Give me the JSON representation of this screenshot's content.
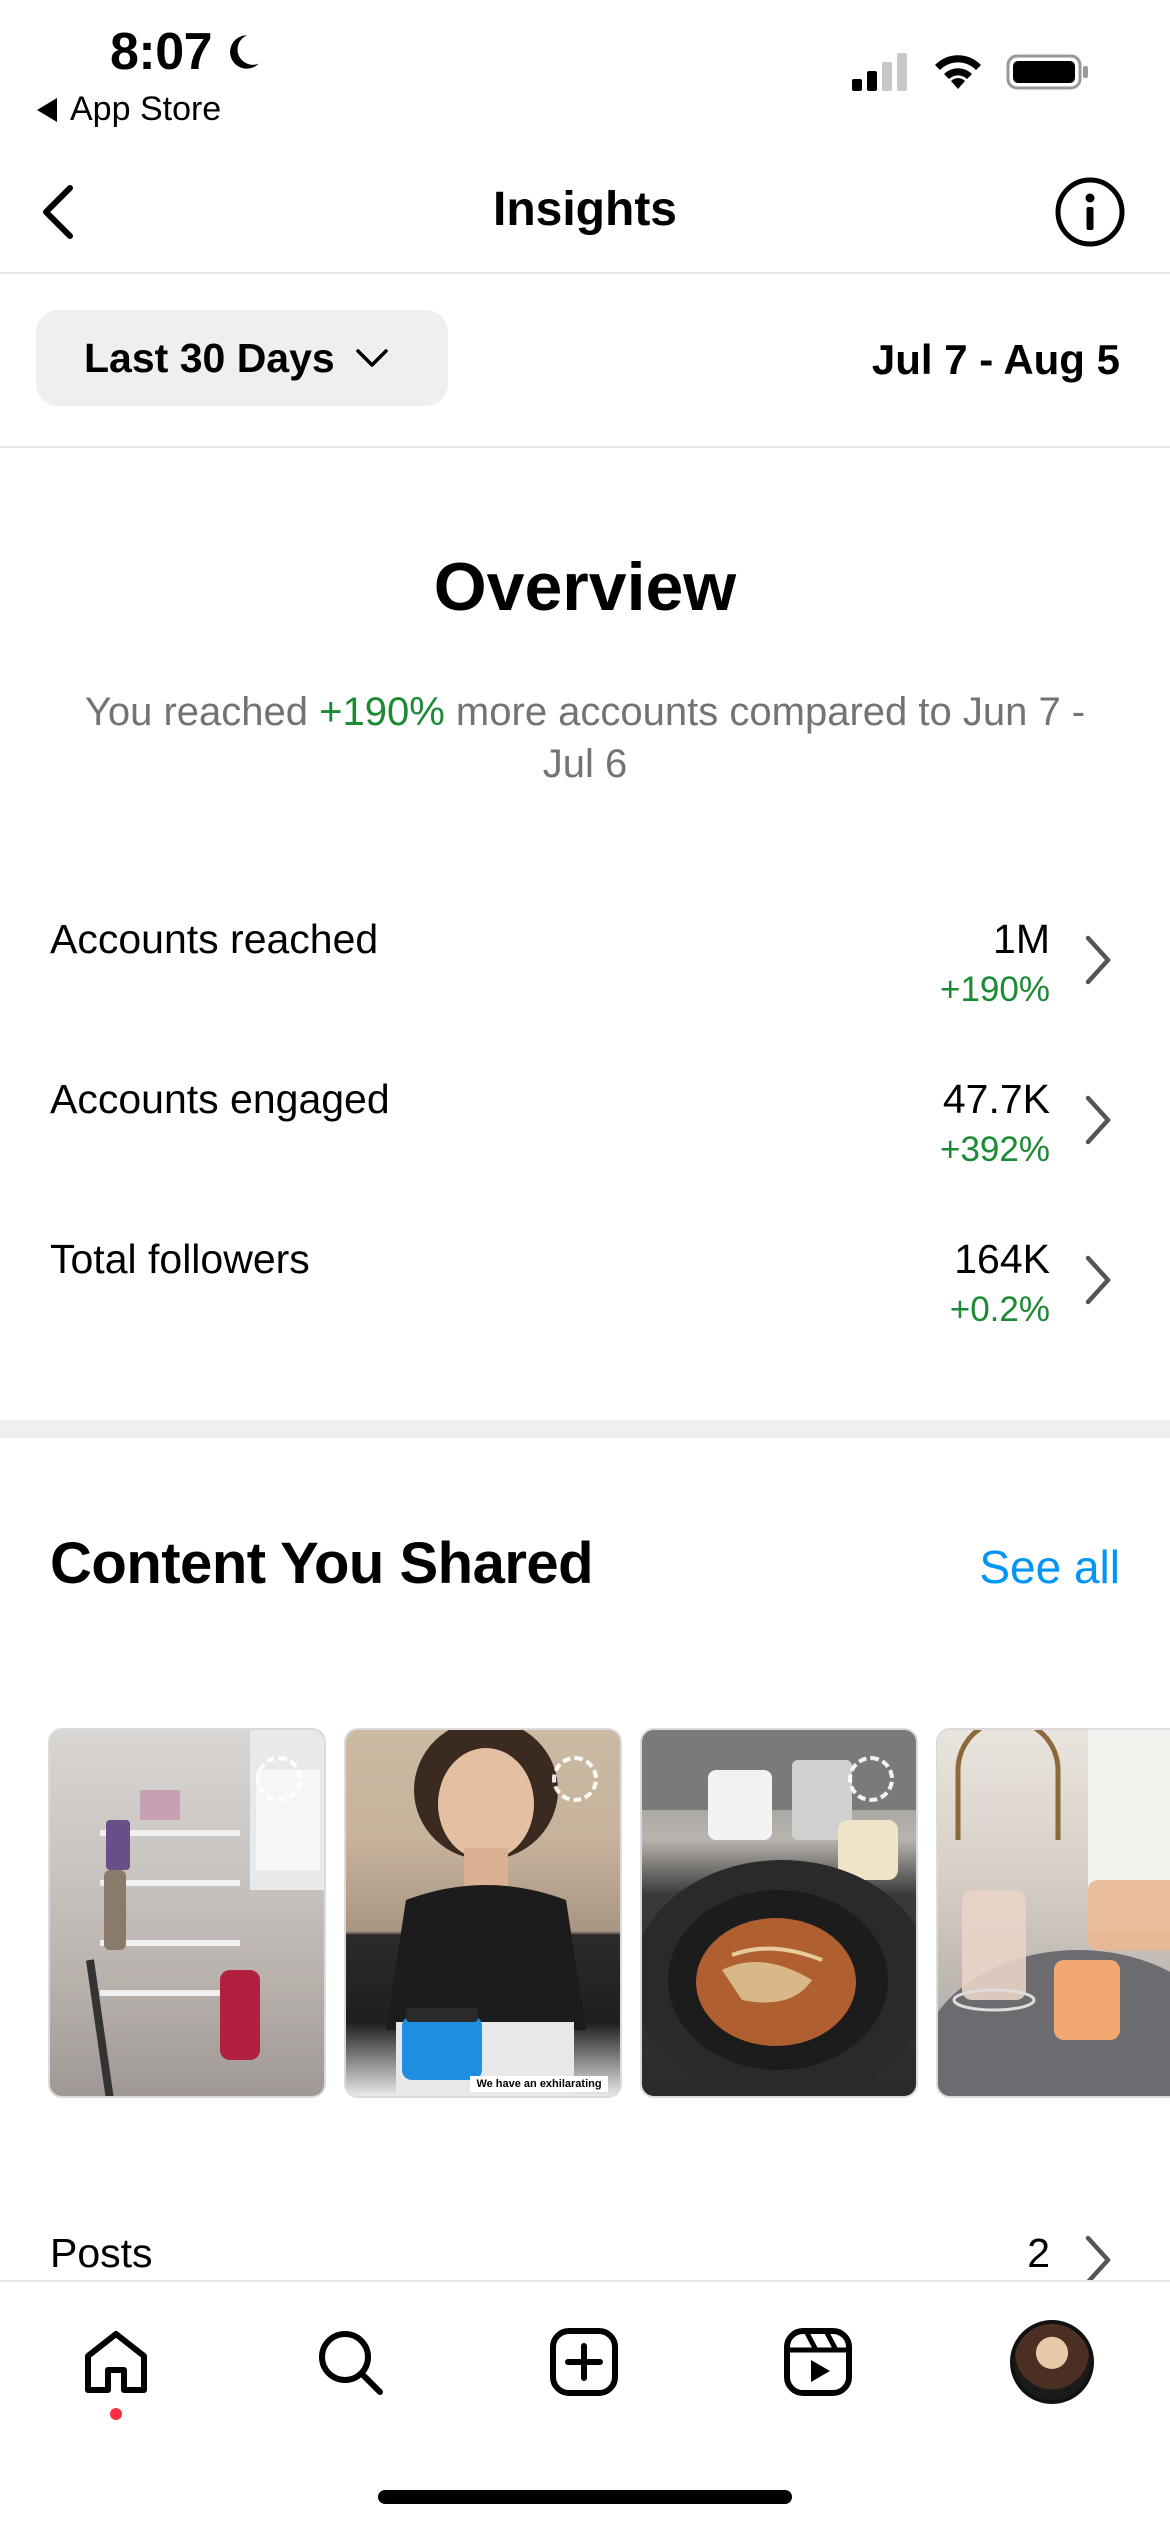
{
  "status_bar": {
    "time": "8:07",
    "back_app": "App Store"
  },
  "header": {
    "title": "Insights"
  },
  "date_range": {
    "selector_label": "Last 30 Days",
    "dates": "Jul 7 - Aug 5"
  },
  "overview": {
    "title": "Overview",
    "desc_prefix": "You reached ",
    "desc_highlight": "+190%",
    "desc_suffix": " more accounts compared to Jun 7 - Jul 6",
    "metrics": [
      {
        "label": "Accounts reached",
        "value": "1M",
        "change": "+190%"
      },
      {
        "label": "Accounts engaged",
        "value": "47.7K",
        "change": "+392%"
      },
      {
        "label": "Total followers",
        "value": "164K",
        "change": "+0.2%"
      }
    ]
  },
  "content_shared": {
    "title": "Content You Shared",
    "see_all": "See all",
    "thumb_caption": "We have an exhilarating",
    "posts_label": "Posts",
    "posts_count": "2"
  },
  "colors": {
    "accent_blue": "#0095f6",
    "positive_green": "#1b8a34",
    "notification_red": "#ff3040"
  }
}
